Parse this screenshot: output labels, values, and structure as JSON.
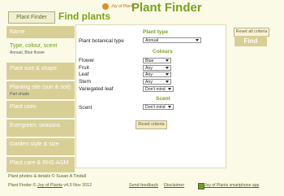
{
  "header": {
    "plant_finder_button": "Plant Finder",
    "find_plants": "Find plants",
    "logo_text": "Joy of Plants",
    "app_title": "Plant Finder"
  },
  "sidebar": {
    "items": [
      {
        "label": "Name"
      },
      {
        "label": "Type, colour, scent",
        "sub": "Annual, Blue flower",
        "active": true
      },
      {
        "label": "Plant size & shape"
      },
      {
        "label": "Planting site (sun & soil)",
        "sub": "Part shade"
      },
      {
        "label": "Plant uses"
      },
      {
        "label": "Evergreen, seasons"
      },
      {
        "label": "Garden style & size"
      },
      {
        "label": "Plant care & RHS AGM"
      }
    ]
  },
  "main": {
    "plant_type_heading": "Plant type",
    "plant_botanical_type_label": "Plant botanical type",
    "plant_botanical_type_value": "Annual",
    "colours_heading": "Colours",
    "flower_label": "Flower",
    "flower_value": "Blue",
    "fruit_label": "Fruit",
    "fruit_value": "Any",
    "leaf_label": "Leaf",
    "leaf_value": "Any",
    "stem_label": "Stem",
    "stem_value": "Any",
    "variegated_label": "Variegated leaf",
    "variegated_value": "Don't mind",
    "scent_heading": "Scent",
    "scent_label": "Scent",
    "scent_value": "Don't mind",
    "reset_criteria": "Reset criteria"
  },
  "right": {
    "reset_all_criteria": "Reset all criteria",
    "find": "Find"
  },
  "footer": {
    "line1": "Plant photos & details © Susan A Tindall",
    "line2_prefix": "Plant Finder © ",
    "line2_link": "Joy of Plants",
    "line2_suffix": " v4.5 Nov 2012",
    "send_feedback": "Send feedback",
    "disclaimer": "Disclaimer",
    "smartphone_app": "Joy of Plants smartphone app"
  },
  "colors": {
    "accent_green": "#7aa11f",
    "sidebar_tan": "#d8cf97",
    "page_background": "#fbfae6"
  }
}
